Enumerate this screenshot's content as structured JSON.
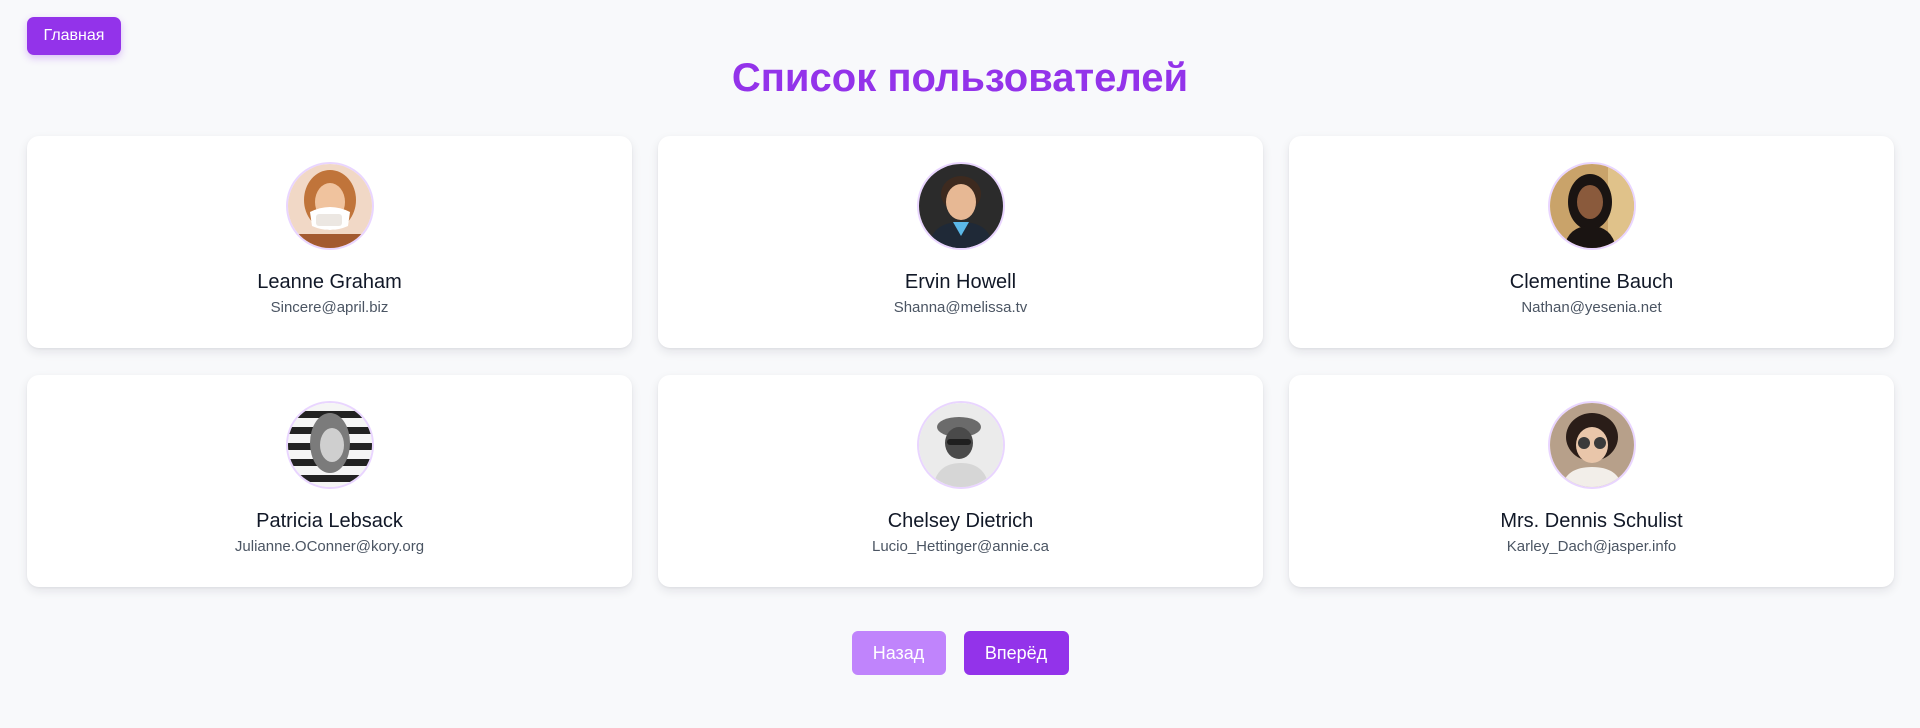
{
  "nav": {
    "home_label": "Главная"
  },
  "page": {
    "title": "Список пользователей"
  },
  "users": [
    {
      "name": "Leanne Graham",
      "email": "Sincere@april.biz"
    },
    {
      "name": "Ervin Howell",
      "email": "Shanna@melissa.tv"
    },
    {
      "name": "Clementine Bauch",
      "email": "Nathan@yesenia.net"
    },
    {
      "name": "Patricia Lebsack",
      "email": "Julianne.OConner@kory.org"
    },
    {
      "name": "Chelsey Dietrich",
      "email": "Lucio_Hettinger@annie.ca"
    },
    {
      "name": "Mrs. Dennis Schulist",
      "email": "Karley_Dach@jasper.info"
    }
  ],
  "pagination": {
    "prev_label": "Назад",
    "next_label": "Вперёд"
  },
  "colors": {
    "accent": "#9333ea",
    "accent_disabled": "#c084fc",
    "background": "#f8f9fb",
    "card": "#ffffff"
  }
}
